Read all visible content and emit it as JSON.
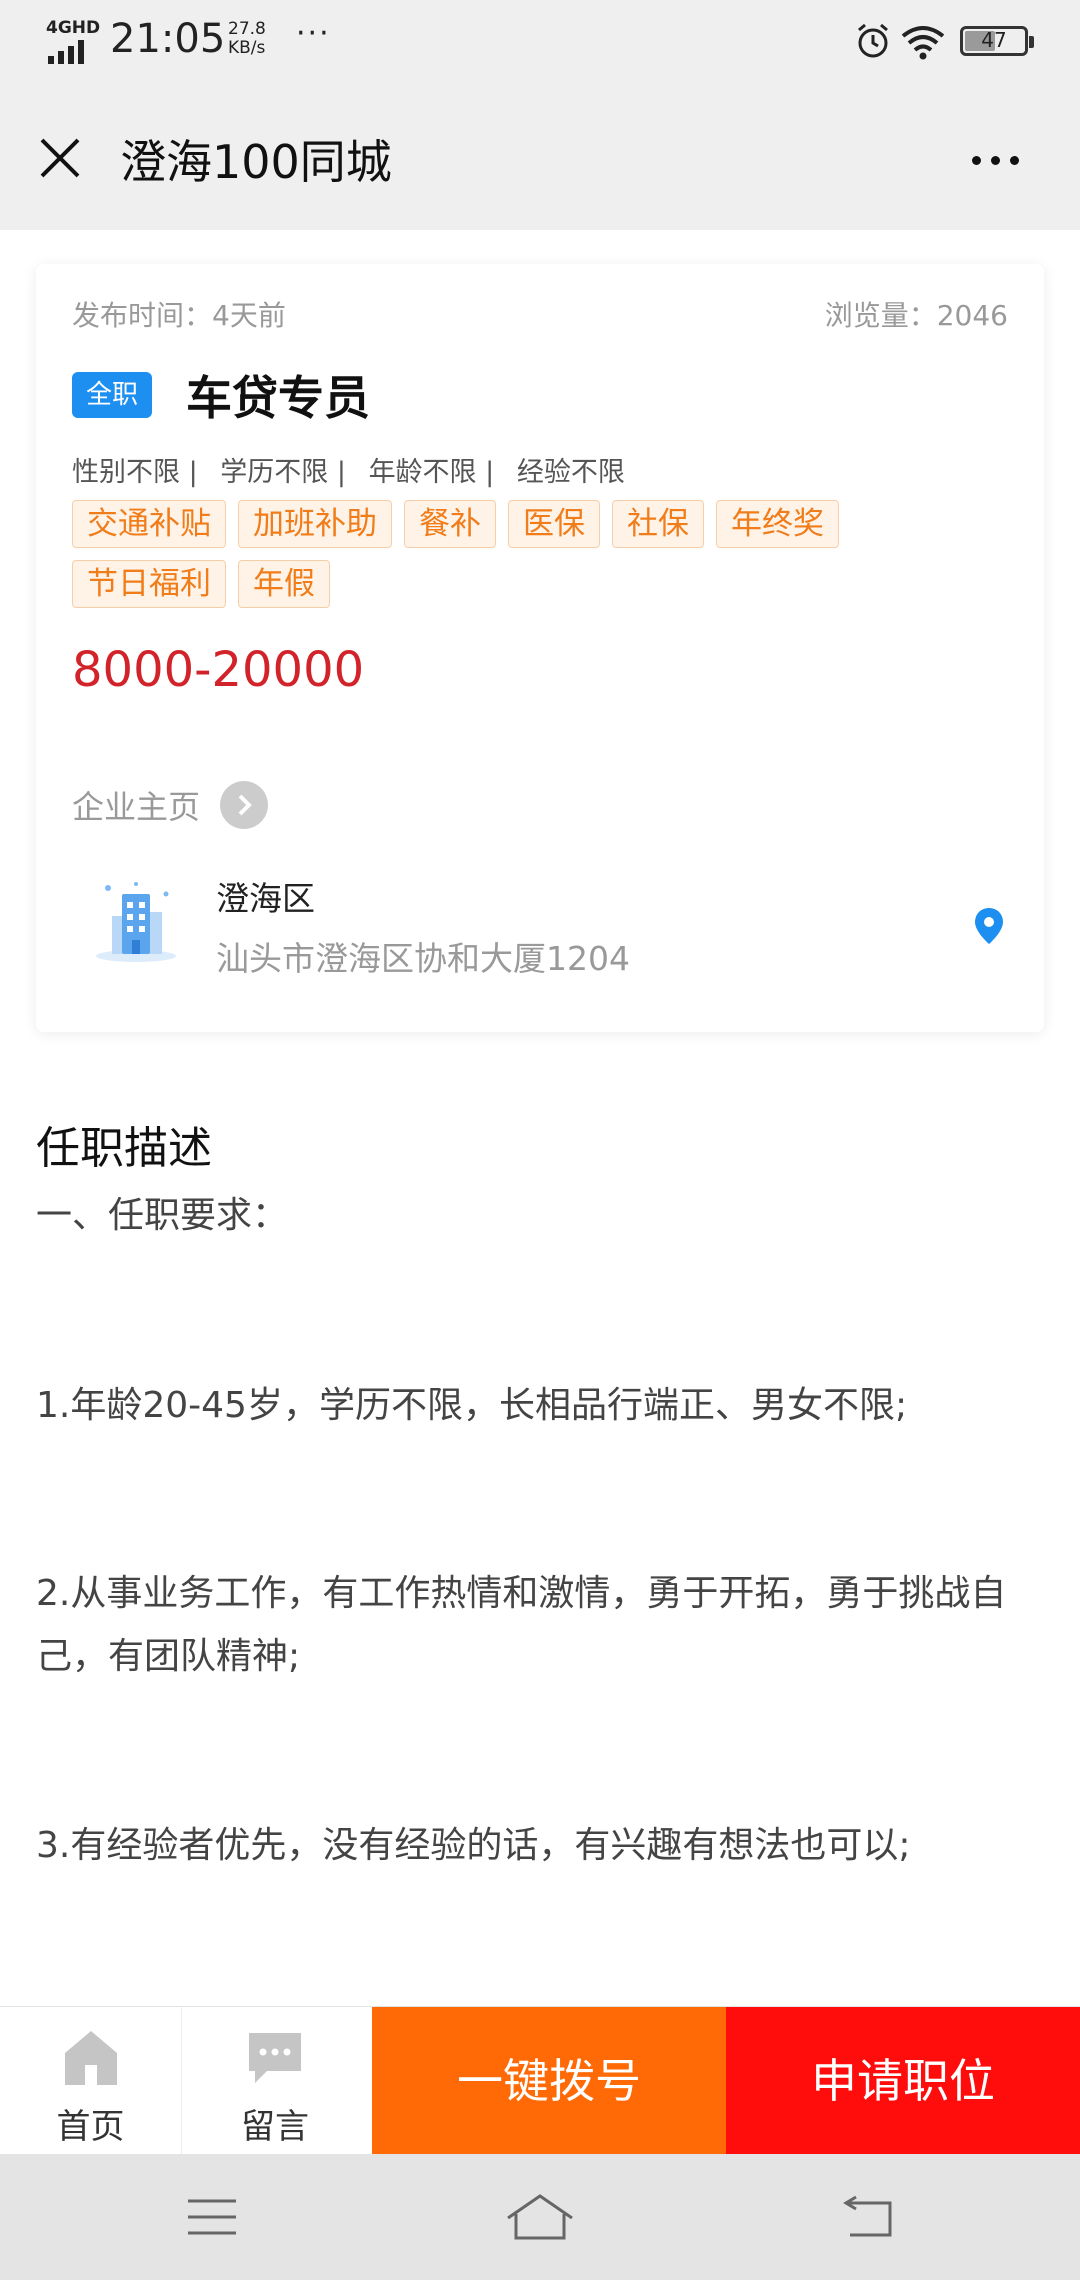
{
  "status_bar": {
    "network": "4GHD",
    "time": "21:05",
    "speed_value": "27.8",
    "speed_unit": "KB/s",
    "dots": "···",
    "battery": "47"
  },
  "header": {
    "title": "澄海100同城"
  },
  "job": {
    "publish_time": "发布时间：4天前",
    "views": "浏览量：2046",
    "type": "全职",
    "title": "车贷专员",
    "requirements": [
      "性别不限 |",
      "学历不限 |",
      "年龄不限 |",
      "经验不限"
    ],
    "benefits": [
      "交通补贴",
      "加班补助",
      "餐补",
      "医保",
      "社保",
      "年终奖",
      "节日福利",
      "年假"
    ],
    "salary": "8000-20000",
    "company_link": "企业主页",
    "district": "澄海区",
    "address": "汕头市澄海区协和大厦1204"
  },
  "description": {
    "title": "任职描述",
    "lines": [
      "一、任职要求：",
      "1.年龄20-45岁，学历不限，长相品行端正、男女不限;",
      "2.从事业务工作，有工作热情和激情，勇于开拓，勇于挑战自己，有团队精神;",
      "3.有经验者优先，没有经验的话，有兴趣有想法也可以;"
    ]
  },
  "bottom_bar": {
    "home": "首页",
    "message": "留言",
    "dial": "一键拨号",
    "apply": "申请职位"
  },
  "colors": {
    "accent_blue": "#1c8ff0",
    "tag_orange": "#f07d1a",
    "salary_red": "#d2232a",
    "dial_orange": "#ff6a06",
    "apply_red": "#ff0d0d"
  }
}
